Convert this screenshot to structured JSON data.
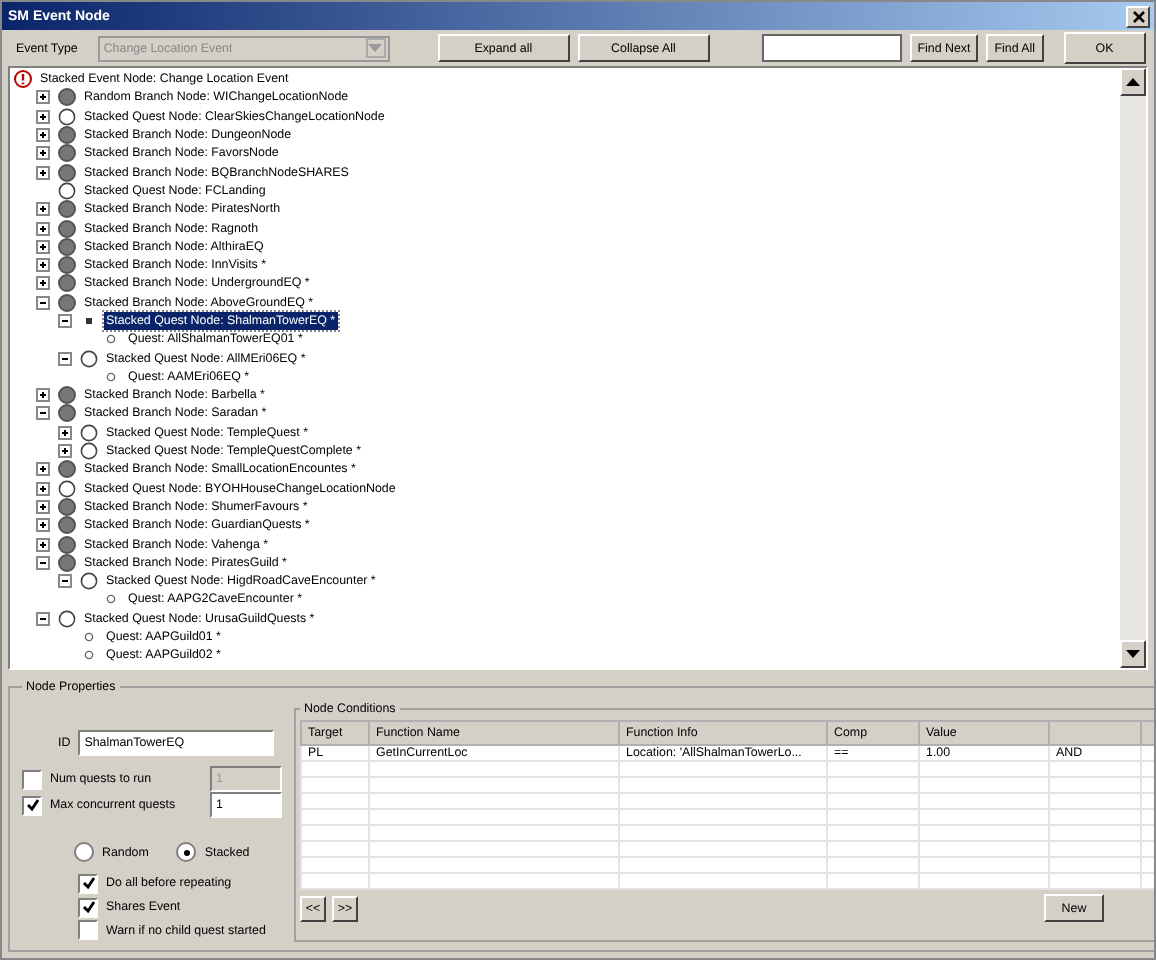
{
  "window": {
    "title": "SM Event Node"
  },
  "toolbar": {
    "event_type_label": "Event Type",
    "event_type": {
      "value": "Change Location Event",
      "disabled": true
    },
    "buttons": [
      "Expand all",
      "Collapse All"
    ],
    "find_buttons": [
      "Find Next",
      "Find All"
    ],
    "ok": "OK"
  },
  "tree": {
    "root": {
      "label": "Stacked Event Node: Change Location Event",
      "kind": "event",
      "selected": false,
      "children": [
        {
          "label": "Random Branch Node: WIChangeLocationNode",
          "kind": "branch",
          "expanded": false,
          "selected": false
        },
        {
          "label": "Stacked Quest Node: ClearSkiesChangeLocationNode",
          "kind": "quest-node",
          "expanded": false,
          "selected": false
        },
        {
          "label": "Stacked Branch Node: DungeonNode",
          "kind": "branch",
          "expanded": false,
          "selected": false
        },
        {
          "label": "Stacked Branch Node: FavorsNode",
          "kind": "branch",
          "expanded": false,
          "selected": false
        },
        {
          "label": "Stacked Branch Node: BQBranchNodeSHARES",
          "kind": "branch",
          "expanded": false,
          "selected": false
        },
        {
          "label": "Stacked Quest Node: FCLanding",
          "kind": "quest-node",
          "selected": false
        },
        {
          "label": "Stacked Branch Node: PiratesNorth",
          "kind": "branch",
          "expanded": false,
          "selected": false
        },
        {
          "label": "Stacked Branch Node: Ragnoth",
          "kind": "branch",
          "expanded": false,
          "selected": false
        },
        {
          "label": "Stacked Branch Node: AlthiraEQ",
          "kind": "branch",
          "expanded": false,
          "selected": false
        },
        {
          "label": "Stacked Branch Node: InnVisits *",
          "kind": "branch",
          "expanded": false,
          "selected": false
        },
        {
          "label": "Stacked Branch Node: UndergroundEQ *",
          "kind": "branch",
          "expanded": false,
          "selected": false
        },
        {
          "label": "Stacked Branch Node: AboveGroundEQ *",
          "kind": "branch",
          "expanded": true,
          "selected": false,
          "children": [
            {
              "label": "Stacked Quest Node: ShalmanTowerEQ *",
              "kind": "bullet",
              "expanded": true,
              "selected": true,
              "children": [
                {
                  "label": "Quest: AllShalmanTowerEQ01 *",
                  "kind": "quest",
                  "selected": false
                }
              ]
            },
            {
              "label": "Stacked Quest Node: AllMEri06EQ *",
              "kind": "quest-node",
              "expanded": true,
              "selected": false,
              "children": [
                {
                  "label": "Quest: AAMEri06EQ *",
                  "kind": "quest",
                  "selected": false
                }
              ]
            }
          ]
        },
        {
          "label": "Stacked Branch Node: Barbella *",
          "kind": "branch",
          "expanded": false,
          "selected": false
        },
        {
          "label": "Stacked Branch Node: Saradan *",
          "kind": "branch",
          "expanded": true,
          "selected": false,
          "children": [
            {
              "label": "Stacked Quest Node: TempleQuest *",
              "kind": "quest-node",
              "expanded": false,
              "selected": false
            },
            {
              "label": "Stacked Quest Node: TempleQuestComplete *",
              "kind": "quest-node",
              "expanded": false,
              "selected": false
            }
          ]
        },
        {
          "label": "Stacked Branch Node: SmallLocationEncountes *",
          "kind": "branch",
          "expanded": false,
          "selected": false
        },
        {
          "label": "Stacked Quest Node: BYOHHouseChangeLocationNode",
          "kind": "quest-node",
          "expanded": false,
          "selected": false
        },
        {
          "label": "Stacked Branch Node: ShumerFavours *",
          "kind": "branch",
          "expanded": false,
          "selected": false
        },
        {
          "label": "Stacked Branch Node: GuardianQuests *",
          "kind": "branch",
          "expanded": false,
          "selected": false
        },
        {
          "label": "Stacked Branch Node: Vahenga *",
          "kind": "branch",
          "expanded": false,
          "selected": false
        },
        {
          "label": "Stacked Branch Node: PiratesGuild *",
          "kind": "branch",
          "expanded": true,
          "selected": false,
          "children": [
            {
              "label": "Stacked Quest Node: HigdRoadCaveEncounter *",
              "kind": "quest-node",
              "expanded": true,
              "selected": false,
              "children": [
                {
                  "label": "Quest: AAPG2CaveEncounter *",
                  "kind": "quest",
                  "selected": false
                }
              ]
            }
          ]
        },
        {
          "label": "Stacked Quest Node: UrusaGuildQuests *",
          "kind": "quest-node",
          "expanded": true,
          "selected": false,
          "children": [
            {
              "label": "Quest: AAPGuild01 *",
              "kind": "quest",
              "selected": false
            },
            {
              "label": "Quest: AAPGuild02 *",
              "kind": "quest",
              "selected": false
            }
          ]
        }
      ]
    }
  },
  "node_properties": {
    "title": "Node Properties",
    "id_label": "ID",
    "id_value": "ShalmanTowerEQ",
    "limits": [
      {
        "label": "Num quests to run",
        "checked": false,
        "value": "1",
        "disabled": true
      },
      {
        "label": "Max concurrent quests",
        "checked": true,
        "value": "1",
        "disabled": false
      }
    ],
    "modes": [
      {
        "label": "Random",
        "selected": false
      },
      {
        "label": "Stacked",
        "selected": true
      }
    ],
    "options": [
      {
        "label": "Do all before repeating",
        "checked": true
      },
      {
        "label": "Shares Event",
        "checked": true
      },
      {
        "label": "Warn if no child quest started",
        "checked": false
      }
    ]
  },
  "node_conditions": {
    "title": "Node Conditions",
    "columns": [
      "Target",
      "Function Name",
      "Function Info",
      "Comp",
      "Value"
    ],
    "rows": [
      [
        "PL",
        "GetInCurrentLoc",
        "Location: 'AllShalmanTowerLo...",
        "==",
        "1.00",
        "AND"
      ]
    ],
    "nav_buttons": [
      "<<",
      ">>"
    ],
    "new_button": "New"
  }
}
